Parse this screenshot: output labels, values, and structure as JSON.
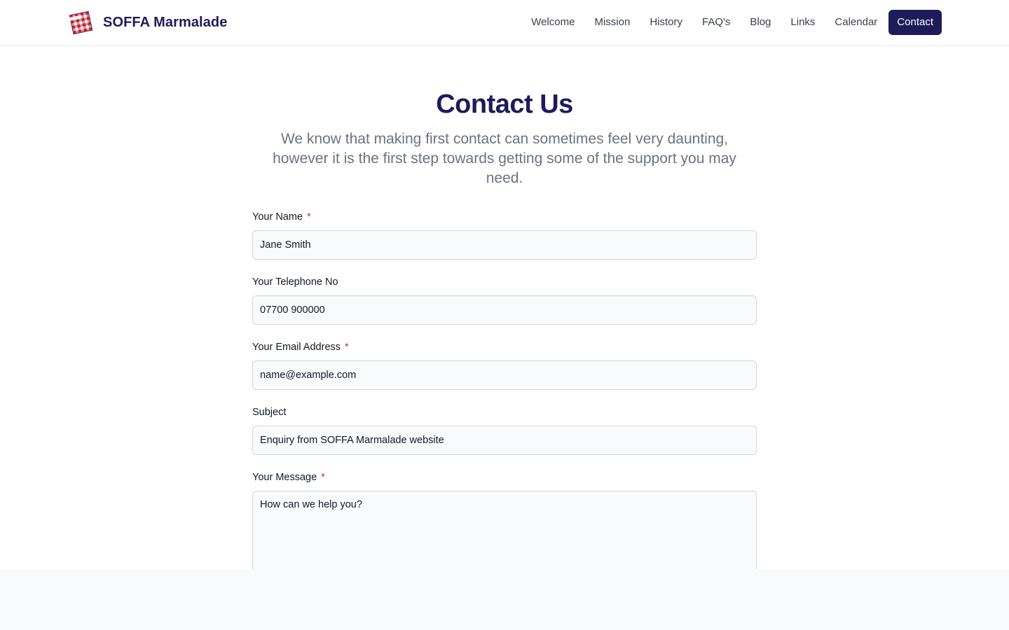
{
  "brand": {
    "name": "SOFFA Marmalade"
  },
  "nav": {
    "items": [
      "Welcome",
      "Mission",
      "History",
      "FAQ's",
      "Blog",
      "Links",
      "Calendar"
    ],
    "active": "Contact"
  },
  "page": {
    "title": "Contact Us",
    "intro": "We know that making first contact can sometimes feel very daunting, however it is the first step towards getting some of the support you may need."
  },
  "form": {
    "name": {
      "label": "Your Name",
      "required_mark": "*",
      "value": "Jane Smith"
    },
    "phone": {
      "label": "Your Telephone No",
      "value": "07700 900000"
    },
    "email": {
      "label": "Your Email Address",
      "required_mark": "*",
      "value": "name@example.com"
    },
    "subject": {
      "label": "Subject",
      "value": "Enquiry from SOFFA Marmalade website"
    },
    "message": {
      "label": "Your Message",
      "required_mark": "*",
      "value": "How can we help you?"
    }
  },
  "colors": {
    "brand": "#1e1b5b",
    "required": "#dc2626",
    "muted_text": "#6b7280",
    "input_bg": "#f9fafb",
    "logo_red": "#d3303e"
  },
  "icons": {
    "logo": "gingham-marmalade-label-icon"
  }
}
